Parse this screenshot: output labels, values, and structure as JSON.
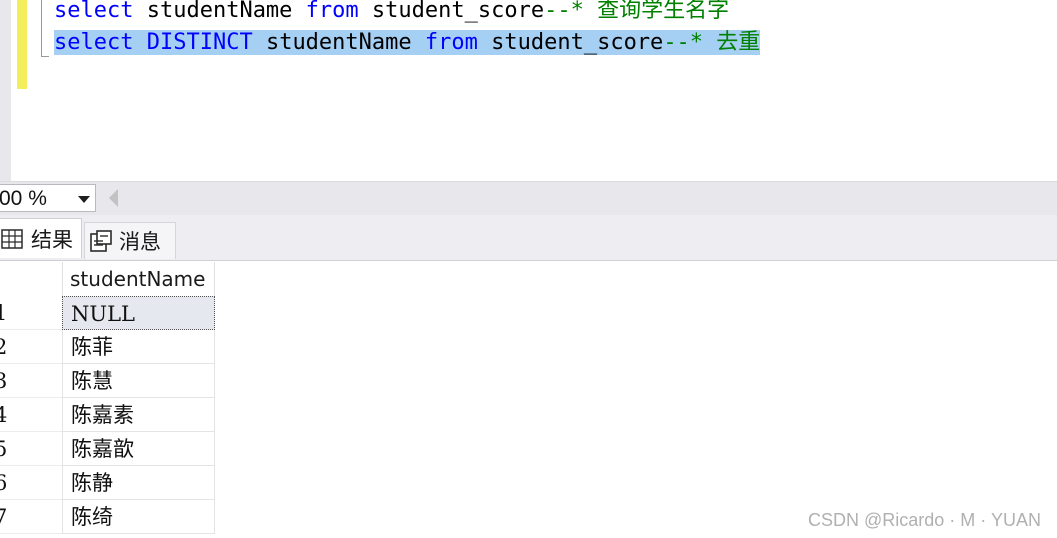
{
  "editor": {
    "lines": [
      {
        "keyword1": "select",
        "text1": " studentName ",
        "keyword2": "from",
        "text2": " student_score",
        "comment": "--* 查询学生名字"
      },
      {
        "keyword1": "select",
        "keyword_mid": " DISTINCT",
        "text1": " studentName ",
        "keyword2": "from",
        "text2": " student_score",
        "comment": "--* 去重"
      }
    ]
  },
  "zoom": {
    "value": "00 %"
  },
  "tabs": [
    {
      "label": "结果",
      "icon": "grid-icon"
    },
    {
      "label": "消息",
      "icon": "messages-icon"
    }
  ],
  "grid": {
    "columns": [
      "studentName"
    ],
    "rows": [
      {
        "num": "1",
        "studentName": "NULL"
      },
      {
        "num": "2",
        "studentName": "陈菲"
      },
      {
        "num": "3",
        "studentName": "陈慧"
      },
      {
        "num": "4",
        "studentName": "陈嘉素"
      },
      {
        "num": "5",
        "studentName": "陈嘉歆"
      },
      {
        "num": "6",
        "studentName": "陈静"
      },
      {
        "num": "7",
        "studentName": "陈绮"
      }
    ]
  },
  "watermark": "CSDN @Ricardo · M · YUAN",
  "colors": {
    "keyword": "#0000ff",
    "comment": "#008000",
    "selection": "#a6cff4",
    "change_bar": "#f3ee5b"
  }
}
